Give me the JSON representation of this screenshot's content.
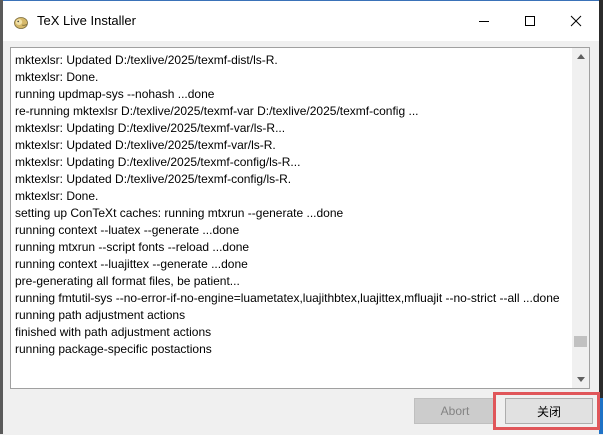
{
  "window": {
    "title": "TeX Live Installer",
    "icon": "tex-live-lion-icon"
  },
  "title_controls": [
    "minimize-icon",
    "maximize-icon",
    "close-icon"
  ],
  "log": {
    "lines": [
      "mktexlsr: Updated D:/texlive/2025/texmf-dist/ls-R.",
      "mktexlsr: Done.",
      "running updmap-sys --nohash ...done",
      "re-running mktexlsr D:/texlive/2025/texmf-var D:/texlive/2025/texmf-config ...",
      "mktexlsr: Updating D:/texlive/2025/texmf-var/ls-R...",
      "mktexlsr: Updated D:/texlive/2025/texmf-var/ls-R.",
      "mktexlsr: Updating D:/texlive/2025/texmf-config/ls-R...",
      "mktexlsr: Updated D:/texlive/2025/texmf-config/ls-R.",
      "mktexlsr: Done.",
      "setting up ConTeXt caches: running mtxrun --generate ...done",
      "running context --luatex --generate ...done",
      "running mtxrun --script fonts --reload ...done",
      "running context --luajittex --generate ...done",
      "pre-generating all format files, be patient...",
      "running fmtutil-sys --no-error-if-no-engine=luametatex,luajithbtex,luajittex,mfluajit --no-strict --all ...done",
      "running path adjustment actions",
      "finished with path adjustment actions",
      "running package-specific postactions"
    ],
    "scroll_position": 0.92
  },
  "buttons": {
    "abort_label": "Abort",
    "close_label": "关闭"
  },
  "colors": {
    "highlight": "#e0565a",
    "title_accent": "#3a72b8",
    "taskbar_accent": "#1f72c6"
  }
}
